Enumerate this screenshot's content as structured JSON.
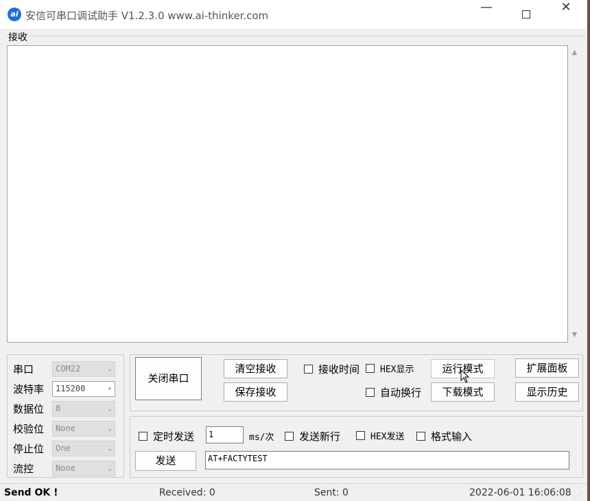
{
  "window": {
    "title": "安信可串口调试助手 V1.2.3.0    www.ai-thinker.com",
    "icon_text": "ai",
    "minimize_glyph": "—",
    "close_glyph": "✕"
  },
  "receive": {
    "label": "接收",
    "content": ""
  },
  "settings": {
    "port": {
      "label": "串口",
      "value": "COM22"
    },
    "baud": {
      "label": "波特率",
      "value": "115200"
    },
    "databits": {
      "label": "数据位",
      "value": "8"
    },
    "parity": {
      "label": "校验位",
      "value": "None"
    },
    "stopbits": {
      "label": "停止位",
      "value": "One"
    },
    "flow": {
      "label": "流控",
      "value": "None"
    }
  },
  "controls": {
    "close_port": "关闭串口",
    "clear_recv": "清空接收",
    "save_recv": "保存接收",
    "recv_time": "接收时间",
    "hex_display": "HEX显示",
    "auto_newline": "自动换行",
    "run_mode": "运行模式",
    "download_mode": "下载模式",
    "expand_panel": "扩展面板",
    "show_history": "显示历史"
  },
  "send": {
    "timed_send": "定时发送",
    "interval_value": "1",
    "interval_unit": "ms/次",
    "send_newline": "发送新行",
    "hex_send": "HEX发送",
    "format_input": "格式输入",
    "send_button": "发送",
    "send_text": "AT+FACTYTEST"
  },
  "status": {
    "message": "Send OK !",
    "received": "Received: 0",
    "sent": "Sent: 0",
    "time": "2022-06-01 16:06:08"
  },
  "colors": {
    "accent": "#1f6fd6",
    "window_bg": "#f0f0f0"
  }
}
